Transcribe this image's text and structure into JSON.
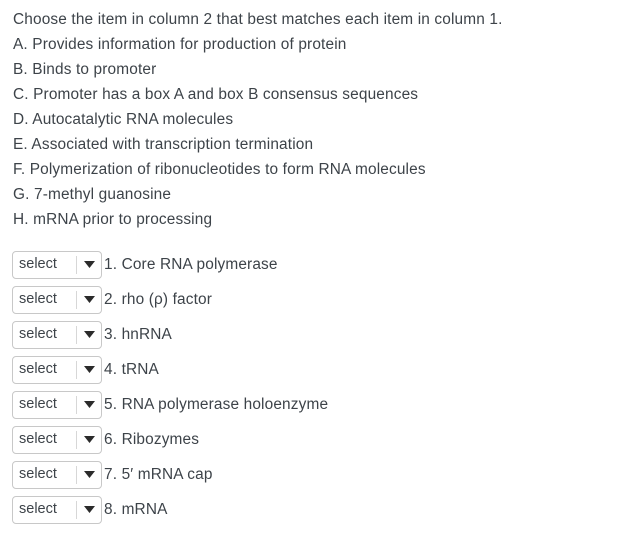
{
  "question": {
    "prompt": "Choose the item in column 2 that best matches each item in column 1.",
    "column1_options": [
      "A. Provides information for production of protein",
      "B. Binds to promoter",
      "C. Promoter has a box A and box B consensus sequences",
      "D. Autocatalytic RNA molecules",
      "E. Associated with transcription termination",
      "F. Polymerization of ribonucleotides to form RNA molecules",
      "G. 7-methyl guanosine",
      "H. mRNA prior to processing"
    ],
    "column2_rows": [
      {
        "select_value": "select",
        "label": "1. Core RNA polymerase"
      },
      {
        "select_value": "select",
        "label": "2. rho (ρ) factor"
      },
      {
        "select_value": "select",
        "label": "3. hnRNA"
      },
      {
        "select_value": "select",
        "label": "4. tRNA"
      },
      {
        "select_value": "select",
        "label": "5. RNA polymerase holoenzyme"
      },
      {
        "select_value": "select",
        "label": "6. Ribozymes"
      },
      {
        "select_value": "select",
        "label": "7. 5′ mRNA cap"
      },
      {
        "select_value": "select",
        "label": "8. mRNA"
      }
    ]
  },
  "colors": {
    "background": "#ffffff",
    "text": "#3d4349",
    "select_border": "#c8c8c8",
    "select_divider": "#d7d7d7",
    "arrow": "#2b2b2b"
  },
  "icons": {
    "dropdown_arrow": "chevron-down-icon"
  }
}
